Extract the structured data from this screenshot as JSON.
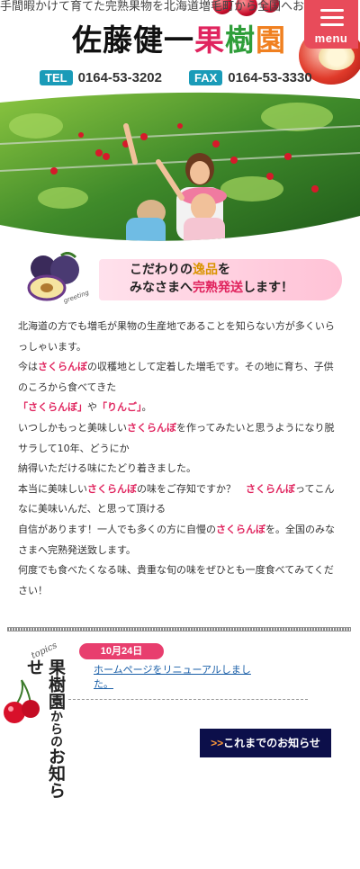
{
  "header": {
    "tagline": "手間暇かけて育てた完熟果物を北海道増毛町から全国へお届け",
    "logo": {
      "part1": "佐藤健一",
      "part2": "果",
      "part3": "樹",
      "part4": "園"
    },
    "menu_label": "menu",
    "tel_label": "TEL",
    "tel_number": "0164-53-3202",
    "fax_label": "FAX",
    "fax_number": "0164-53-3330"
  },
  "catch": {
    "line1_a": "こだわりの",
    "line1_b": "逸品",
    "line1_c": "を",
    "line2_a": "みなさまへ",
    "line2_b": "完熟発送",
    "line2_c": "します！",
    "plum_caption": "greeting"
  },
  "intro": {
    "p1": "北海道の方でも増毛が果物の生産地であることを知らない方が多くいらっしゃいます。",
    "p2_a": "今は",
    "cherry": "さくらんぼ",
    "p2_b": "の収穫地として定着した増毛です。その地に育ち、子供のころから食べてきた",
    "p3_a": "「さくらんぼ」",
    "p3_b": "や",
    "p3_c": "「りんご」",
    "p3_d": "。",
    "p4_a": "いつしかもっと美味しい",
    "p4_b": "を作ってみたいと思うようになり脱サラして10年、どうにか",
    "p5": "納得いただける味にたどり着きました。",
    "p6_a": "本当に美味しい",
    "p6_b": "の味をご存知ですか？　",
    "p6_c": "ってこんなに美味いんだ、と思って頂ける",
    "p7_a": "自信があります！一人でも多くの方に自慢の",
    "p7_b": "を。全国のみなさまへ完熟発送致します。",
    "p8": "何度でも食べたくなる味、貴重な旬の味をぜひとも一度食べてみてください！"
  },
  "topics": {
    "script_label": "topics",
    "title_a": "果樹園",
    "title_b": "からの",
    "title_c": "お知らせ",
    "news": [
      {
        "date": "10月24日",
        "title": "ホームページをリニューアルしました。"
      }
    ],
    "more_arrows": ">>",
    "more_label": "これまでのお知らせ"
  },
  "colors": {
    "accent_pink": "#e0245e",
    "badge_blue": "#1a9bb8",
    "menu_red": "#e84b5a",
    "navy": "#0c0f4a"
  }
}
